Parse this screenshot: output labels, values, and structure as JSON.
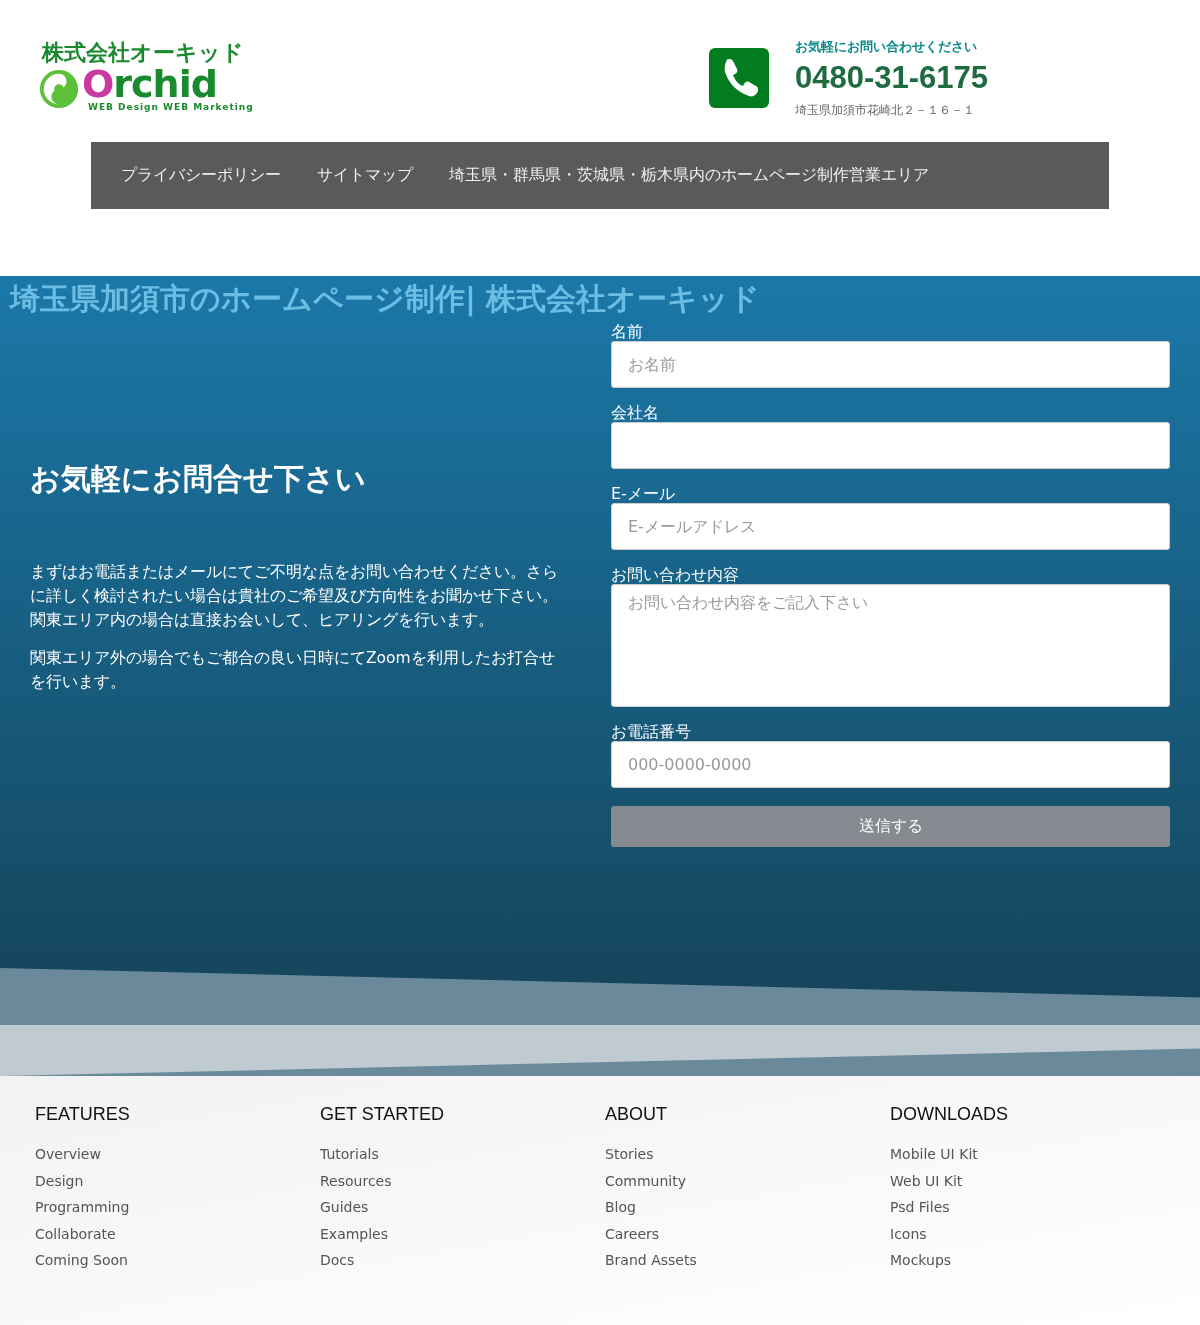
{
  "header": {
    "logo": {
      "company": "株式会社オーキッド",
      "wordmark": "Orchid",
      "tagline": "WEB Design WEB Marketing"
    },
    "contact": {
      "prompt": "お気軽にお問い合わせください",
      "phone": "0480-31-6175",
      "address": "埼玉県加須市花崎北２－１６－１"
    }
  },
  "nav": [
    "プライバシーポリシー",
    "サイトマップ",
    "埼玉県・群馬県・茨城県・栃木県内のホームページ制作営業エリア"
  ],
  "site_title": "埼玉県加須市のホームページ制作| 株式会社オーキッド",
  "intro": {
    "heading": "お気軽にお問合せ下さい",
    "paragraphs": [
      "まずはお電話またはメールにてご不明な点をお問い合わせください。さらに詳しく検討されたい場合は貴社のご希望及び方向性をお聞かせ下さい。関東エリア内の場合は直接お会いして、ヒアリングを行います。",
      "関東エリア外の場合でもご都合の良い日時にてZoomを利用したお打合せを行います。"
    ]
  },
  "form": {
    "fields": [
      {
        "label": "名前",
        "kind": "input",
        "placeholder": "お名前"
      },
      {
        "label": "会社名",
        "kind": "input"
      },
      {
        "label": "E-メール",
        "kind": "input",
        "placeholder": "E-メールアドレス"
      },
      {
        "label": "お問い合わせ内容",
        "kind": "textarea",
        "placeholder": "お問い合わせ内容をご記入下さい"
      },
      {
        "label": "お電話番号",
        "kind": "input",
        "placeholder": "000-0000-0000"
      }
    ],
    "submit": "送信する"
  },
  "footer": {
    "columns": [
      {
        "title": "FEATURES",
        "links": [
          "Overview",
          "Design",
          "Programming",
          "Collaborate",
          "Coming Soon"
        ]
      },
      {
        "title": "GET STARTED",
        "links": [
          "Tutorials",
          "Resources",
          "Guides",
          "Examples",
          "Docs"
        ]
      },
      {
        "title": "ABOUT",
        "links": [
          "Stories",
          "Community",
          "Blog",
          "Careers",
          "Brand Assets"
        ]
      },
      {
        "title": "DOWNLOADS",
        "links": [
          "Mobile UI Kit",
          "Web UI Kit",
          "Psd Files",
          "Icons",
          "Mockups"
        ]
      }
    ]
  }
}
